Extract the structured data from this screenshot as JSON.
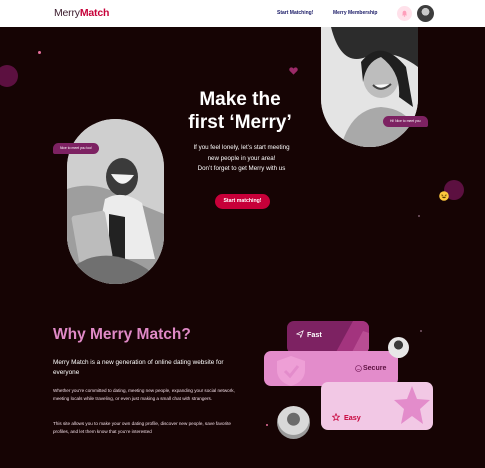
{
  "nav": {
    "logo_part1": "Merry",
    "logo_part2": "Match",
    "links": [
      "Start Matching!",
      "Merry Membership"
    ]
  },
  "hero": {
    "title_line1": "Make the",
    "title_line2": "first ‘Merry’",
    "subtitle_lines": [
      "If you feel lonely, let’s start meeting",
      "new people in your area!",
      "Don’t forget to get Merry with us"
    ],
    "cta_label": "Start matching!",
    "bubble_left": "Nice to meet you too!",
    "bubble_right": "Hi! Nice to meet you"
  },
  "why": {
    "title": "Why Merry Match?",
    "lead": "Merry Match is a new generation of online dating website for everyone",
    "paragraph1": "Whether you’re committed to dating, meeting new people, expanding your social network, meeting locals while traveling, or even just making a small chat with strangers.",
    "paragraph2": "This site allows you to make your own dating profile, discover new people, save favorite profiles, and let them know that you’re interested"
  },
  "features": [
    {
      "label": "Fast",
      "icon": "paper-plane-icon"
    },
    {
      "label": "Secure",
      "icon": "shield-icon"
    },
    {
      "label": "Easy",
      "icon": "star-icon"
    }
  ],
  "colors": {
    "brand_red": "#c70039",
    "nav_text": "#191a66",
    "background": "#160404",
    "why_title": "#df89c6",
    "bubble": "#7d2262"
  }
}
